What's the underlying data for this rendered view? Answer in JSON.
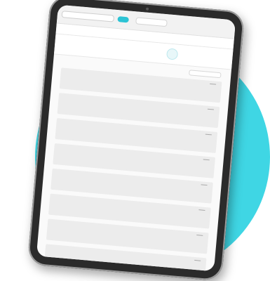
{
  "colors": {
    "circle": "#3fd6e4",
    "accent": "#2cc3d4",
    "frame": "#2b2b2b"
  },
  "cards": [
    {},
    {},
    {},
    {},
    {},
    {},
    {},
    {}
  ]
}
